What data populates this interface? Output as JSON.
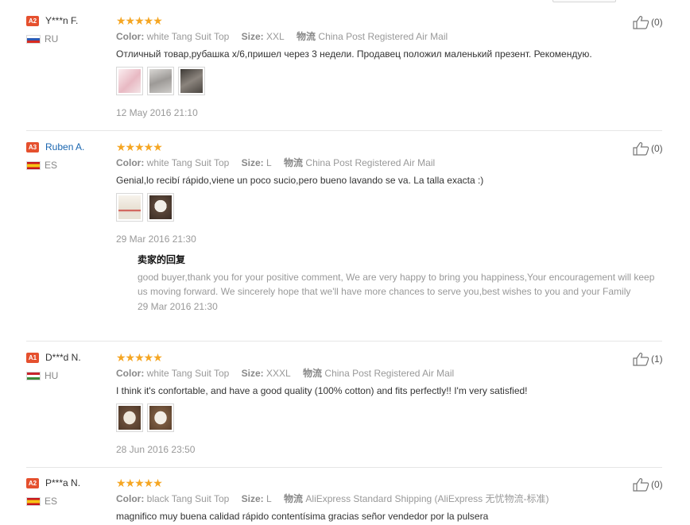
{
  "reviews": [
    {
      "level": "A2",
      "user": "Y***n F.",
      "country": "RU",
      "stars": "★★★★★",
      "color_label": "Color:",
      "color_value": "white Tang Suit Top",
      "size_label": "Size:",
      "size_value": "XXL",
      "shipping_label": "物流",
      "shipping_value": "China Post Registered Air Mail",
      "text": "Отличный товар,рубашка x/6,пришел через 3 недели. Продавец положил маленький презент. Рекомендую.",
      "photos": [
        "#f2dfe3",
        "#b9b7b5",
        "#6a645f"
      ],
      "date": "12 May 2016 21:10",
      "likes": "(0)"
    },
    {
      "level": "A3",
      "user": "Ruben A.",
      "country": "ES",
      "stars": "★★★★★",
      "color_label": "Color:",
      "color_value": "white Tang Suit Top",
      "size_label": "Size:",
      "size_value": "L",
      "shipping_label": "物流",
      "shipping_value": "China Post Registered Air Mail",
      "text": "Genial,lo recibí rápido,viene un poco sucio,pero bueno lavando se va. La talla exacta :)",
      "photos": [
        "#efe9df",
        "#4e3b30"
      ],
      "date": "29 Mar 2016 21:30",
      "likes": "(0)",
      "reply": {
        "title": "卖家的回复",
        "text": "good buyer,thank you for your positive comment, We are very happy to bring you happiness,Your encouragement will keep us moving forward. We sincerely hope that we'll have more chances to serve you,best wishes to you and your Family",
        "date": "29 Mar 2016 21:30"
      }
    },
    {
      "level": "A1",
      "user": "D***d N.",
      "country": "HU",
      "stars": "★★★★★",
      "color_label": "Color:",
      "color_value": "white Tang Suit Top",
      "size_label": "Size:",
      "size_value": "XXXL",
      "shipping_label": "物流",
      "shipping_value": "China Post Registered Air Mail",
      "text": "I think it's confortable, and have a good quality (100% cotton) and fits perfectly!! I'm very satisfied!",
      "photos": [
        "#6e5440",
        "#7b5c44"
      ],
      "date": "28 Jun 2016 23:50",
      "likes": "(1)"
    },
    {
      "level": "A2",
      "user": "P***a N.",
      "country": "ES",
      "stars": "★★★★★",
      "color_label": "Color:",
      "color_value": "black Tang Suit Top",
      "size_label": "Size:",
      "size_value": "L",
      "shipping_label": "物流",
      "shipping_value": "AliExpress Standard Shipping (AliExpress 无忧物流-标准)",
      "text": "magnifico muy buena calidad rápido contentísima gracias señor vendedor por la pulsera",
      "likes": "(0)"
    }
  ]
}
